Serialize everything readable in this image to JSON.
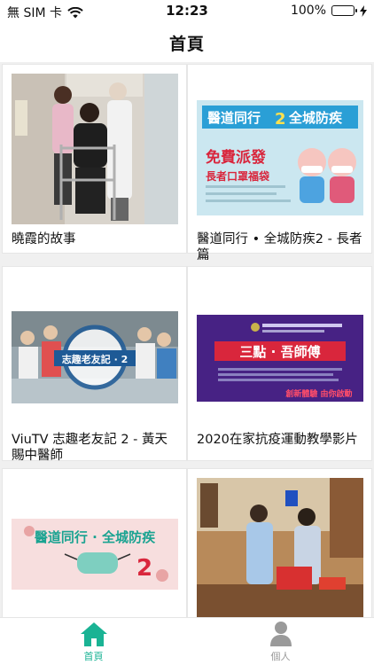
{
  "status_bar": {
    "carrier": "無 SIM 卡",
    "time": "12:23",
    "battery_percent_text": "100%",
    "battery_level": 1.0,
    "wifi_icon": "wifi-icon",
    "charging_icon": "bolt-icon"
  },
  "nav": {
    "title": "首頁"
  },
  "feed": {
    "items": [
      {
        "title": "曉霞的故事",
        "thumb_icon": "photo-walker-rehab"
      },
      {
        "title": "醫道同行 • 全城防疾2 - 長者篇",
        "thumb_icon": "poster-elderly-masks",
        "thumb_text": {
          "headline": "醫道同行",
          "headline_num": "2",
          "headline_tail": "全城防疾",
          "promo": "免費派發",
          "promo_sub": "長者口罩福袋"
        }
      },
      {
        "title": "ViuTV 志趣老友記 2 - 黃天賜中醫師",
        "thumb_icon": "photo-crowd-logo",
        "thumb_text": {
          "logo": "志趣老友記 · 2"
        }
      },
      {
        "title": "2020在家抗疫運動教學影片",
        "thumb_icon": "poster-three-oclock",
        "thumb_text": {
          "headline": "三點 · 吾師傅",
          "tagline": "創新體驗 由你啟動"
        }
      },
      {
        "title": "",
        "thumb_icon": "poster-mask-banner",
        "thumb_text": {
          "headline": "醫道同行 · 全城防疾",
          "num": "2"
        }
      },
      {
        "title": "",
        "thumb_icon": "photo-clinic-volunteers"
      }
    ]
  },
  "tab_bar": {
    "tabs": [
      {
        "label": "首頁",
        "icon": "home-icon",
        "active": true
      },
      {
        "label": "個人",
        "icon": "person-icon",
        "active": false
      }
    ]
  },
  "colors": {
    "accent": "#1ab394",
    "inactive": "#9a9a9a",
    "battery": "#2ecc40"
  }
}
